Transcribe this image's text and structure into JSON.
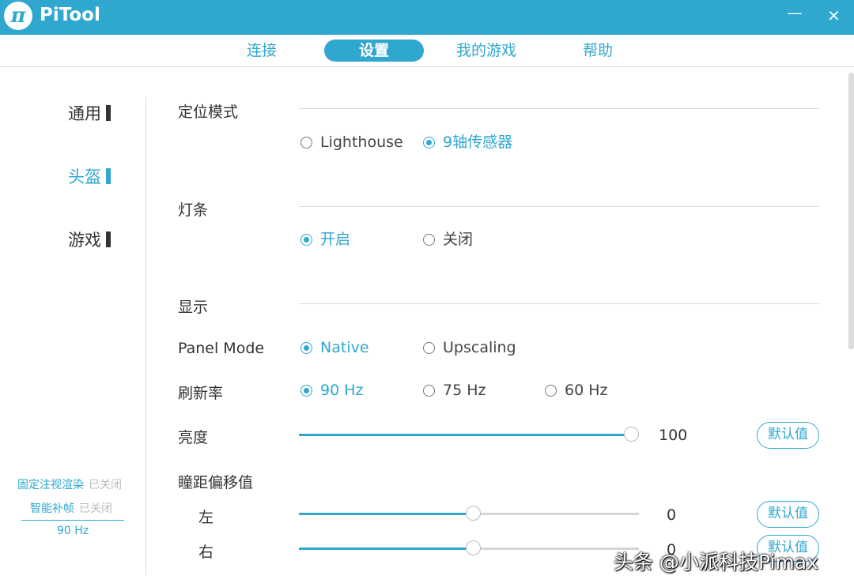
{
  "app": {
    "logo_glyph": "π",
    "title": "PiTool",
    "minimize_glyph": "—",
    "close_glyph": "✕"
  },
  "tabs": [
    {
      "label": "连接",
      "active": false
    },
    {
      "label": "设置",
      "active": true
    },
    {
      "label": "我的游戏",
      "active": false
    },
    {
      "label": "帮助",
      "active": false
    }
  ],
  "sidebar": {
    "items": [
      {
        "label": "通用",
        "active": false
      },
      {
        "label": "头盔",
        "active": true
      },
      {
        "label": "游戏",
        "active": false
      }
    ],
    "status": [
      {
        "label": "固定注视渲染",
        "value": "已关闭"
      },
      {
        "label": "智能补帧",
        "value": "已关闭"
      }
    ],
    "refresh": "90 Hz"
  },
  "sections": {
    "tracking": {
      "label": "定位模式",
      "options": [
        {
          "label": "Lighthouse",
          "checked": false
        },
        {
          "label": "9轴传感器",
          "checked": true
        }
      ]
    },
    "lightbar": {
      "label": "灯条",
      "options": [
        {
          "label": "开启",
          "checked": true
        },
        {
          "label": "关闭",
          "checked": false
        }
      ]
    },
    "display": {
      "label": "显示",
      "panel_mode": {
        "label": "Panel Mode",
        "options": [
          {
            "label": "Native",
            "checked": true
          },
          {
            "label": "Upscaling",
            "checked": false
          }
        ]
      },
      "refresh_rate": {
        "label": "刷新率",
        "options": [
          {
            "label": "90 Hz",
            "checked": true
          },
          {
            "label": "75 Hz",
            "checked": false
          },
          {
            "label": "60 Hz",
            "checked": false
          }
        ]
      },
      "brightness": {
        "label": "亮度",
        "value": "100",
        "fraction": 1.0,
        "reset": "默认值"
      },
      "ipd_offset": {
        "label": "瞳距偏移值",
        "left": {
          "label": "左",
          "value": "0",
          "fraction": 0.5,
          "reset": "默认值"
        },
        "right": {
          "label": "右",
          "value": "0",
          "fraction": 0.5,
          "reset": "默认值"
        }
      }
    }
  },
  "watermark": "头条 @小派科技Pimax",
  "colors": {
    "accent": "#2fa7cf",
    "titlebar": "#2fa7cf",
    "text": "#333333",
    "muted": "#bbbbbb"
  }
}
